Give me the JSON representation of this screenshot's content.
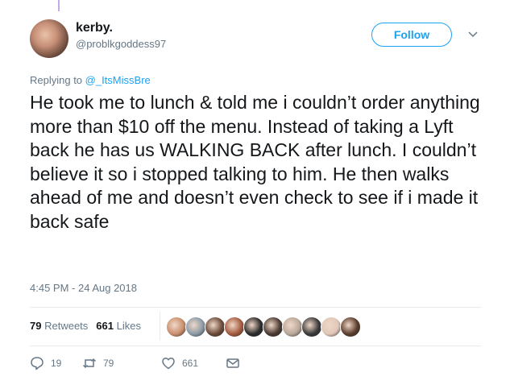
{
  "tweet": {
    "author_name": "kerby.",
    "author_handle": "@problkgoddess97",
    "follow_label": "Follow",
    "replying_prefix": "Replying to ",
    "replying_to": "@_ItsMissBre",
    "text": "He took me to lunch & told me i couldn’t order anything more than $10 off the menu. Instead of taking a Lyft back he has us WALKING BACK after lunch. I couldn’t believe it so i stopped talking to him. He then walks ahead of me and doesn’t even check to see if i made it back safe",
    "timestamp": "4:45 PM - 24 Aug 2018"
  },
  "stats": {
    "retweets_count": "79",
    "retweets_label": "Retweets",
    "likes_count": "661",
    "likes_label": "Likes"
  },
  "likers": [
    {
      "icon": "liker-avatar-1",
      "color": "#c98e6c"
    },
    {
      "icon": "liker-avatar-2",
      "color": "#8a9aa6"
    },
    {
      "icon": "liker-avatar-3",
      "color": "#6b4a3a"
    },
    {
      "icon": "liker-avatar-4",
      "color": "#a45a3e"
    },
    {
      "icon": "liker-avatar-5",
      "color": "#2b2b2b"
    },
    {
      "icon": "liker-avatar-6",
      "color": "#4a3a32"
    },
    {
      "icon": "liker-avatar-7",
      "color": "#b9a89a"
    },
    {
      "icon": "liker-avatar-8",
      "color": "#3a3a3a"
    },
    {
      "icon": "liker-avatar-9",
      "color": "#e0c7b8"
    },
    {
      "icon": "liker-avatar-10",
      "color": "#5a3c2c"
    }
  ],
  "actions": {
    "reply_count": "19",
    "retweet_count": "79",
    "like_count": "661"
  },
  "colors": {
    "accent": "#1da1f2",
    "secondary_text": "#657786",
    "primary_text": "#14171a"
  }
}
